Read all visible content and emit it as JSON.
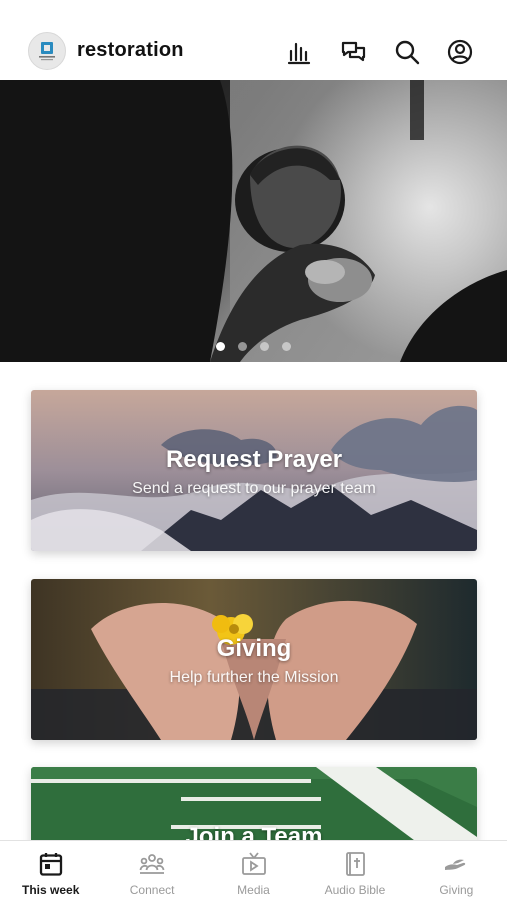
{
  "header": {
    "app_name": "restoration",
    "logo_icon": "church-logo-icon",
    "icons": [
      "audio-bars-icon",
      "chat-bubbles-icon",
      "search-icon",
      "profile-icon"
    ]
  },
  "carousel": {
    "slide_count": 4,
    "active_index": 0
  },
  "cards": [
    {
      "title": "Request Prayer",
      "subtitle": "Send a request to our prayer team"
    },
    {
      "title": "Giving",
      "subtitle": "Help further the Mission"
    },
    {
      "title": "Join a Team",
      "subtitle": ""
    }
  ],
  "tabbar": {
    "items": [
      {
        "label": "This week",
        "icon": "calendar-icon",
        "active": true
      },
      {
        "label": "Connect",
        "icon": "people-group-icon",
        "active": false
      },
      {
        "label": "Media",
        "icon": "tv-icon",
        "active": false
      },
      {
        "label": "Audio Bible",
        "icon": "bible-icon",
        "active": false
      },
      {
        "label": "Giving",
        "icon": "giving-hand-icon",
        "active": false
      }
    ]
  },
  "colors": {
    "active_tab": "#1a1a1a",
    "inactive_tab": "#9a9a9a",
    "turf_green": "#2f6e3c"
  }
}
